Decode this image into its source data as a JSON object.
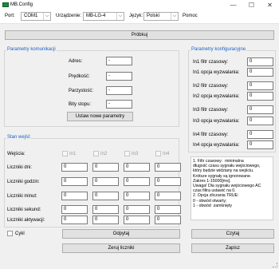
{
  "window": {
    "title": "MB.Config",
    "minimize": "—",
    "maximize": "☐",
    "close": "✕"
  },
  "toolbar": {
    "port_label": "Port:",
    "port_value": "COM1",
    "device_label": "Urządzenie:",
    "device_value": "MB-LG-4",
    "language_label": "Język:",
    "language_value": "Polski",
    "help_label": "Pomoc"
  },
  "probe_button": "Próbkuj",
  "comm": {
    "title": "Parametry komunikacji",
    "fields": [
      {
        "label": "Adres:",
        "value": "-"
      },
      {
        "label": "Prędkość:",
        "value": "-"
      },
      {
        "label": "Parzystość:",
        "value": "-"
      },
      {
        "label": "Bity stopu:",
        "value": "-"
      }
    ],
    "set_button": "Ustaw nowe parametry"
  },
  "inputs": {
    "title": "Stan wejść",
    "row_labels": {
      "inputs": "Wejścia:",
      "days": "Liczniki dni:",
      "hours": "Liczniki godzin:",
      "minutes": "Liczniki minut:",
      "seconds": "Liczniki sekund:",
      "activations": "Liczniki aktywacji:"
    },
    "inputs_names": [
      "In1",
      "In2",
      "In3",
      "In4"
    ],
    "counters": {
      "days": [
        "0",
        "0",
        "0",
        "0"
      ],
      "hours": [
        "0",
        "0",
        "0",
        "0"
      ],
      "minutes": [
        "0",
        "0",
        "0",
        "0"
      ],
      "seconds": [
        "0",
        "0",
        "0",
        "0"
      ],
      "activations": [
        "0",
        "0",
        "0",
        "0"
      ]
    },
    "cycle_label": "Cykl",
    "read_button": "Odpytaj",
    "reset_button": "Zeruj liczniki"
  },
  "config": {
    "title": "Parametry konfiguracyjne",
    "rows": [
      {
        "label": "In1 filtr czasowy:",
        "value": "0"
      },
      {
        "label": "In1 opcja wyzwalania:",
        "value": "0"
      },
      {
        "label": "In2 filtr czasowy:",
        "value": "0"
      },
      {
        "label": "In2 opcja wyzwalania:",
        "value": "0"
      },
      {
        "label": "In3 filtr czasowy:",
        "value": "0"
      },
      {
        "label": "In3 opcja wyzwalania:",
        "value": "0"
      },
      {
        "label": "In4 filtr czasowy:",
        "value": "0"
      },
      {
        "label": "In4 opcja wyzwalania:",
        "value": "0"
      }
    ],
    "info": "1. Filtr czasowy:  minimalna\ndługość czasu sygnału wejściowego,\nktóry będzie widziany na wejściu.\nKrótsze sygnały są ignorowane.\nZakres 1-15000[ms].\nUwaga! Dla sygnału wejściowego AC\nczas filtra ustawić na 0.\n2. Opcja zliczania TRUE:\n0 - obwód otwarty;\n1 - obwód  zamknięty",
    "read_button": "Czytaj",
    "write_button": "Zapisz"
  }
}
